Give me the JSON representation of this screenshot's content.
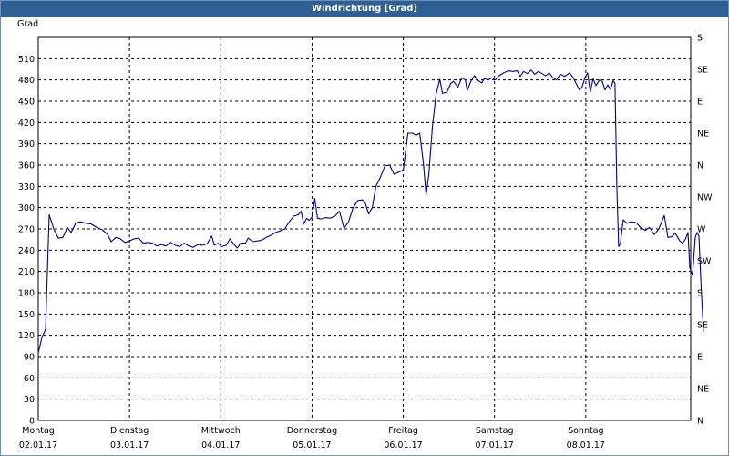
{
  "window": {
    "title": "Windrichtung [Grad]"
  },
  "chart_data": {
    "type": "line",
    "title": "Windrichtung [Grad]",
    "ylabel": "Grad",
    "ylim": [
      0,
      540
    ],
    "yticks": [
      0,
      30,
      60,
      90,
      120,
      150,
      180,
      210,
      240,
      270,
      300,
      330,
      360,
      390,
      420,
      450,
      480,
      510
    ],
    "right_labels": [
      "N",
      "NE",
      "E",
      "SE",
      "S",
      "SW",
      "W",
      "NW",
      "N",
      "NE",
      "E",
      "SE",
      "S"
    ],
    "xlim": [
      0,
      7.15
    ],
    "day_ticks": [
      {
        "day": "Montag",
        "date": "02.01.17"
      },
      {
        "day": "Dienstag",
        "date": "03.01.17"
      },
      {
        "day": "Mittwoch",
        "date": "04.01.17"
      },
      {
        "day": "Donnerstag",
        "date": "05.01.17"
      },
      {
        "day": "Freitag",
        "date": "06.01.17"
      },
      {
        "day": "Samstag",
        "date": "07.01.17"
      },
      {
        "day": "Sonntag",
        "date": "08.01.17"
      }
    ],
    "grid": true,
    "line_color": "#00008b",
    "series": [
      {
        "values": [
          [
            0.0,
            95
          ],
          [
            0.04,
            117
          ],
          [
            0.08,
            128
          ],
          [
            0.12,
            290
          ],
          [
            0.17,
            270
          ],
          [
            0.22,
            257
          ],
          [
            0.27,
            258
          ],
          [
            0.32,
            272
          ],
          [
            0.36,
            265
          ],
          [
            0.41,
            278
          ],
          [
            0.46,
            280
          ],
          [
            0.52,
            278
          ],
          [
            0.58,
            277
          ],
          [
            0.64,
            272
          ],
          [
            0.7,
            269
          ],
          [
            0.76,
            262
          ],
          [
            0.8,
            252
          ],
          [
            0.85,
            258
          ],
          [
            0.9,
            256
          ],
          [
            0.95,
            251
          ],
          [
            1.0,
            253
          ],
          [
            1.05,
            256
          ],
          [
            1.1,
            257
          ],
          [
            1.15,
            250
          ],
          [
            1.2,
            251
          ],
          [
            1.25,
            250
          ],
          [
            1.3,
            246
          ],
          [
            1.35,
            248
          ],
          [
            1.4,
            246
          ],
          [
            1.45,
            251
          ],
          [
            1.5,
            247
          ],
          [
            1.55,
            245
          ],
          [
            1.6,
            250
          ],
          [
            1.65,
            246
          ],
          [
            1.7,
            244
          ],
          [
            1.75,
            248
          ],
          [
            1.8,
            247
          ],
          [
            1.85,
            249
          ],
          [
            1.9,
            260
          ],
          [
            1.93,
            247
          ],
          [
            1.97,
            250
          ],
          [
            2.01,
            245
          ],
          [
            2.06,
            247
          ],
          [
            2.1,
            256
          ],
          [
            2.14,
            249
          ],
          [
            2.18,
            243
          ],
          [
            2.22,
            250
          ],
          [
            2.27,
            250
          ],
          [
            2.3,
            257
          ],
          [
            2.35,
            252
          ],
          [
            2.4,
            253
          ],
          [
            2.45,
            254
          ],
          [
            2.5,
            258
          ],
          [
            2.55,
            261
          ],
          [
            2.6,
            265
          ],
          [
            2.65,
            267
          ],
          [
            2.7,
            270
          ],
          [
            2.75,
            280
          ],
          [
            2.8,
            288
          ],
          [
            2.85,
            290
          ],
          [
            2.88,
            295
          ],
          [
            2.91,
            277
          ],
          [
            2.94,
            285
          ],
          [
            2.97,
            282
          ],
          [
            3.0,
            287
          ],
          [
            3.03,
            313
          ],
          [
            3.06,
            285
          ],
          [
            3.1,
            284
          ],
          [
            3.15,
            286
          ],
          [
            3.2,
            285
          ],
          [
            3.25,
            288
          ],
          [
            3.3,
            295
          ],
          [
            3.35,
            271
          ],
          [
            3.4,
            280
          ],
          [
            3.45,
            300
          ],
          [
            3.5,
            310
          ],
          [
            3.55,
            311
          ],
          [
            3.58,
            308
          ],
          [
            3.62,
            291
          ],
          [
            3.66,
            300
          ],
          [
            3.7,
            330
          ],
          [
            3.75,
            343
          ],
          [
            3.8,
            359
          ],
          [
            3.85,
            360
          ],
          [
            3.9,
            347
          ],
          [
            3.95,
            350
          ],
          [
            4.0,
            353
          ],
          [
            4.05,
            405
          ],
          [
            4.1,
            405
          ],
          [
            4.14,
            402
          ],
          [
            4.18,
            405
          ],
          [
            4.22,
            363
          ],
          [
            4.25,
            318
          ],
          [
            4.28,
            347
          ],
          [
            4.32,
            415
          ],
          [
            4.36,
            460
          ],
          [
            4.4,
            481
          ],
          [
            4.43,
            461
          ],
          [
            4.48,
            463
          ],
          [
            4.52,
            475
          ],
          [
            4.55,
            478
          ],
          [
            4.6,
            470
          ],
          [
            4.64,
            483
          ],
          [
            4.68,
            480
          ],
          [
            4.7,
            465
          ],
          [
            4.74,
            478
          ],
          [
            4.78,
            486
          ],
          [
            4.82,
            479
          ],
          [
            4.86,
            476
          ],
          [
            4.89,
            482
          ],
          [
            4.93,
            480
          ],
          [
            4.97,
            483
          ],
          [
            5.01,
            480
          ],
          [
            5.05,
            486
          ],
          [
            5.1,
            490
          ],
          [
            5.15,
            493
          ],
          [
            5.2,
            492
          ],
          [
            5.25,
            493
          ],
          [
            5.28,
            485
          ],
          [
            5.32,
            492
          ],
          [
            5.36,
            489
          ],
          [
            5.4,
            494
          ],
          [
            5.44,
            488
          ],
          [
            5.48,
            492
          ],
          [
            5.52,
            489
          ],
          [
            5.56,
            486
          ],
          [
            5.6,
            490
          ],
          [
            5.64,
            483
          ],
          [
            5.68,
            480
          ],
          [
            5.72,
            488
          ],
          [
            5.77,
            485
          ],
          [
            5.82,
            490
          ],
          [
            5.86,
            484
          ],
          [
            5.89,
            476
          ],
          [
            5.93,
            466
          ],
          [
            5.96,
            470
          ],
          [
            5.99,
            483
          ],
          [
            6.02,
            490
          ],
          [
            6.05,
            463
          ],
          [
            6.08,
            482
          ],
          [
            6.11,
            472
          ],
          [
            6.15,
            480
          ],
          [
            6.18,
            478
          ],
          [
            6.21,
            466
          ],
          [
            6.24,
            473
          ],
          [
            6.27,
            467
          ],
          [
            6.3,
            479
          ],
          [
            6.32,
            475
          ],
          [
            6.34,
            330
          ],
          [
            6.36,
            245
          ],
          [
            6.38,
            250
          ],
          [
            6.41,
            283
          ],
          [
            6.45,
            278
          ],
          [
            6.5,
            280
          ],
          [
            6.55,
            279
          ],
          [
            6.6,
            272
          ],
          [
            6.65,
            268
          ],
          [
            6.7,
            272
          ],
          [
            6.75,
            262
          ],
          [
            6.8,
            270
          ],
          [
            6.86,
            289
          ],
          [
            6.9,
            258
          ],
          [
            6.94,
            259
          ],
          [
            6.98,
            264
          ],
          [
            7.03,
            253
          ],
          [
            7.06,
            250
          ],
          [
            7.09,
            255
          ],
          [
            7.12,
            265
          ],
          [
            7.14,
            215
          ],
          [
            7.17,
            205
          ],
          [
            7.2,
            258
          ],
          [
            7.22,
            265
          ],
          [
            7.24,
            260
          ],
          [
            7.26,
            200
          ],
          [
            7.29,
            125
          ]
        ]
      }
    ]
  }
}
